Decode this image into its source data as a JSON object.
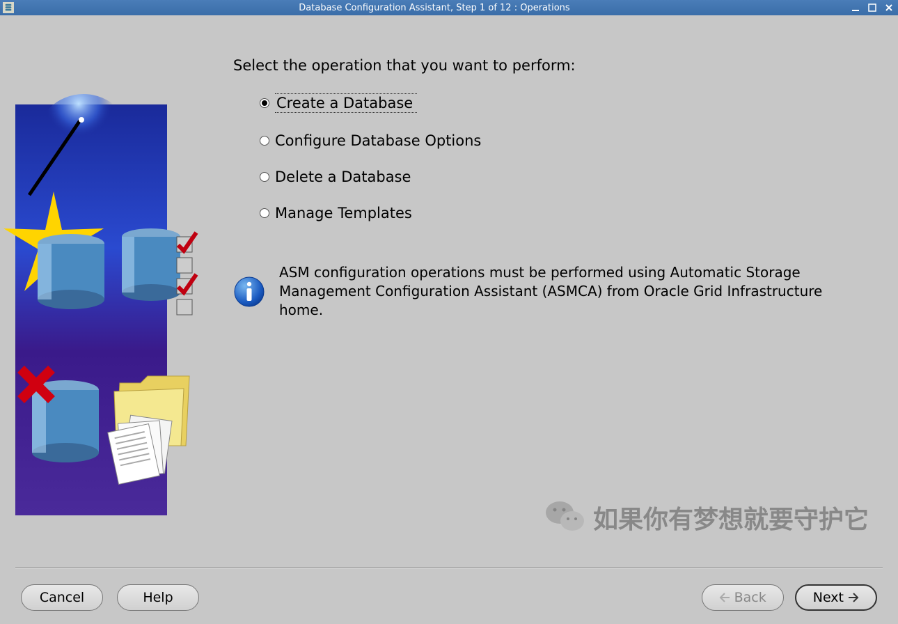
{
  "titlebar": {
    "title": "Database Configuration Assistant, Step 1 of 12 : Operations"
  },
  "instruction": "Select the operation that you want to perform:",
  "options": {
    "create": "Create a Database",
    "configure": "Configure Database Options",
    "delete": "Delete a Database",
    "manage": "Manage Templates"
  },
  "info": "ASM configuration operations must be performed using Automatic Storage Management Configuration Assistant (ASMCA) from Oracle Grid Infrastructure home.",
  "buttons": {
    "cancel": "Cancel",
    "help": "Help",
    "back": "Back",
    "next": "Next"
  },
  "watermark": "如果你有梦想就要守护它"
}
